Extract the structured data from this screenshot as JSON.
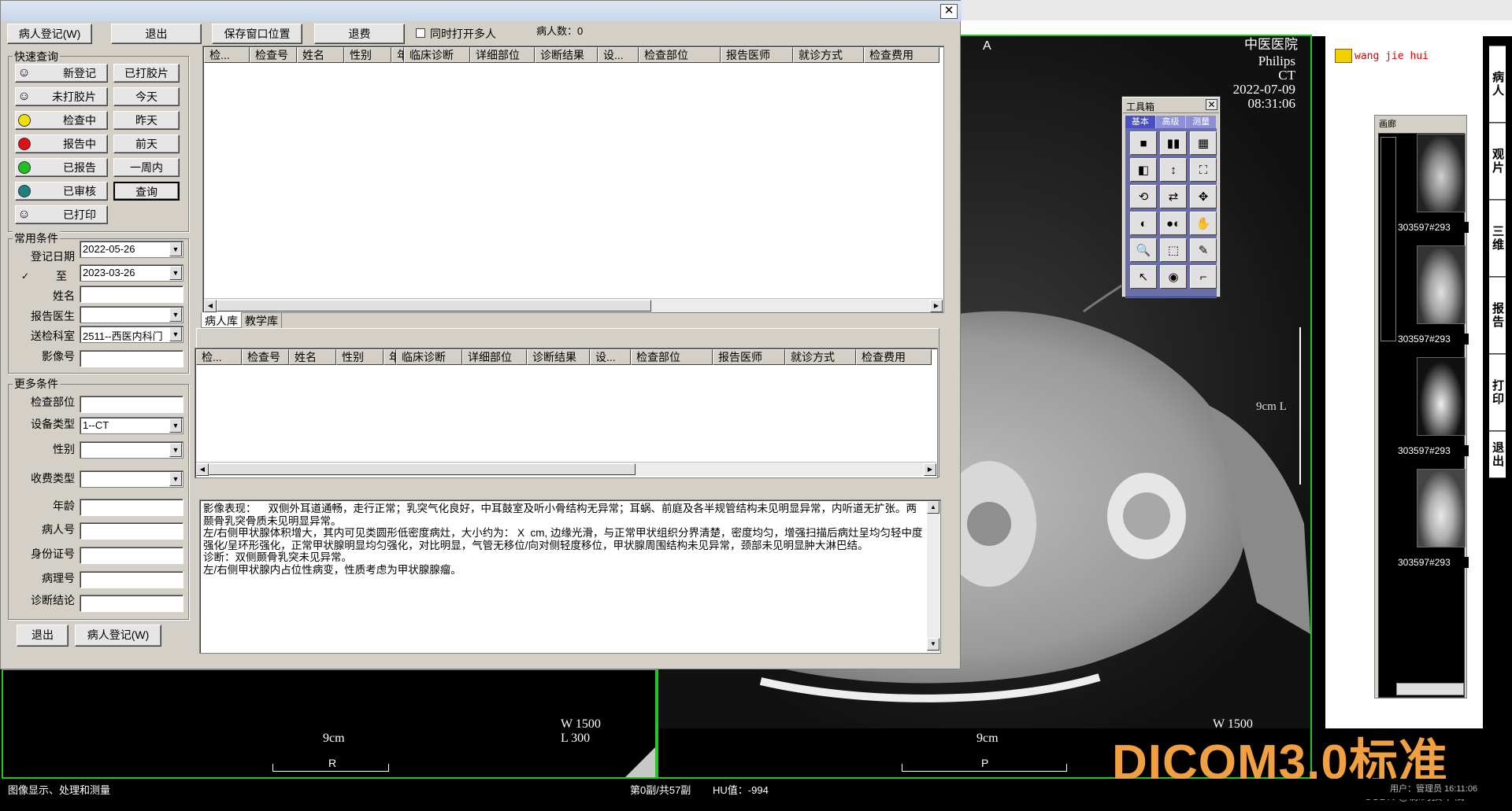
{
  "dialog": {
    "buttons": {
      "register": "病人登记(W)",
      "exit": "退出",
      "save_pos": "保存窗口位置",
      "refund": "退费",
      "exit_bottom": "退出",
      "register_bottom": "病人登记(W)"
    },
    "multi_open_label": "同时打开多人",
    "patient_count": "病人数：0",
    "quick_query": {
      "title": "快速查询",
      "status_items": [
        {
          "label": "新登记",
          "color": "#d4d0c8"
        },
        {
          "label": "未打胶片",
          "color": "#d4d0c8"
        },
        {
          "label": "检查中",
          "color": "#f0e000"
        },
        {
          "label": "报告中",
          "color": "#e01010"
        },
        {
          "label": "已报告",
          "color": "#20c020"
        },
        {
          "label": "已审核",
          "color": "#208080"
        },
        {
          "label": "已打印",
          "color": "#d4d0c8"
        }
      ],
      "time_buttons": [
        "已打胶片",
        "今天",
        "昨天",
        "前天",
        "一周内",
        "查询"
      ]
    },
    "common": {
      "title": "常用条件",
      "reg_date_label": "登记日期",
      "reg_date": "2022-05-26",
      "to_label": "至",
      "to_date": "2023-03-26",
      "name_label": "姓名",
      "doctor_label": "报告医生",
      "dept_label": "送检科室",
      "dept_value": "2511--西医内科门",
      "image_no_label": "影像号"
    },
    "more": {
      "title": "更多条件",
      "part_label": "检查部位",
      "device_label": "设备类型",
      "device_value": "1--CT",
      "sex_label": "性别",
      "fee_label": "收费类型",
      "age_label": "年龄",
      "pid_label": "病人号",
      "idcard_label": "身份证号",
      "path_label": "病理号",
      "diag_label": "诊断结论"
    },
    "columns": [
      "检...",
      "检查号",
      "姓名",
      "性别",
      "年",
      "临床诊断",
      "详细部位",
      "诊断结果",
      "设...",
      "检查部位",
      "报告医师",
      "就诊方式",
      "检查费用"
    ],
    "tabs": [
      "病人库",
      "教学库"
    ],
    "report_lines": [
      "影像表现：    双侧外耳道通畅，走行正常；乳突气化良好，中耳鼓室及听小骨结构无异常；耳蜗、前庭及各半规管结构未见明显异常，内听道无扩张。两颞骨乳突骨质未见明显异常。",
      "左/右侧甲状腺体积增大，其内可见类圆形低密度病灶，大小约为： X  cm, 边缘光滑，与正常甲状组织分界清楚，密度均匀，增强扫描后病灶呈均匀轻中度强化/呈环形强化，正常甲状腺明显均匀强化，对比明显，气管无移位/向对侧轻度移位，甲状腺周围结构未见异常，颈部未见明显肿大淋巴结。",
      "诊断：双侧颞骨乳突未见异常。",
      "左/右侧甲状腺内占位性病变，性质考虑为甲状腺腺瘤。"
    ]
  },
  "viewer": {
    "orientation": "A",
    "hospital": "中医医院",
    "manufacturer": "Philips",
    "modality": "CT",
    "date": "2022-07-09",
    "time": "08:31:06",
    "scale_side": "9cm L",
    "left_pane": {
      "scale": "9cm",
      "w": "W  1500",
      "l": "L   300",
      "ruler_mark": "R"
    },
    "right_pane": {
      "scale": "9cm",
      "w": "W  1500",
      "ruler_mark": "P"
    },
    "toolbox": {
      "title": "工具箱",
      "tabs": [
        "基本",
        "高级",
        "测量"
      ],
      "tools": [
        "layout-1x1-icon",
        "layout-1x2-icon",
        "layout-2x2-icon",
        "pan-series-icon",
        "scroll-icon",
        "fit-icon",
        "rotate-icon",
        "flip-icon",
        "move-icon",
        "invert-icon",
        "window-level-icon",
        "hand-icon",
        "zoom-icon",
        "crop-icon",
        "magic-icon",
        "pointer-icon",
        "reset-icon",
        "annotate-icon"
      ],
      "glyphs": [
        "■",
        "▮▮",
        "▦",
        "◧",
        "↕",
        "⛶",
        "⟲",
        "⇄",
        "✥",
        "◐",
        "●◐",
        "✋",
        "🔍",
        "⬚",
        "✎",
        "↖",
        "◉",
        "⌐"
      ]
    },
    "right_panel": {
      "user": "wang jie hui",
      "gallery_title": "画廊",
      "thumbs": [
        "303597#293",
        "303597#293",
        "303597#293",
        "303597#293"
      ]
    },
    "side_tabs": [
      "病人",
      "观片",
      "三维",
      "报告",
      "打印",
      "退出"
    ]
  },
  "status": {
    "left": "图像显示、处理和测量",
    "page": "第0副/共57副",
    "hu": "HU值：-994",
    "right": "用户：管理员  16:11:06"
  },
  "watermark": {
    "big": "DICOM3.0标准",
    "small": "CSDN @源码技术栈"
  }
}
